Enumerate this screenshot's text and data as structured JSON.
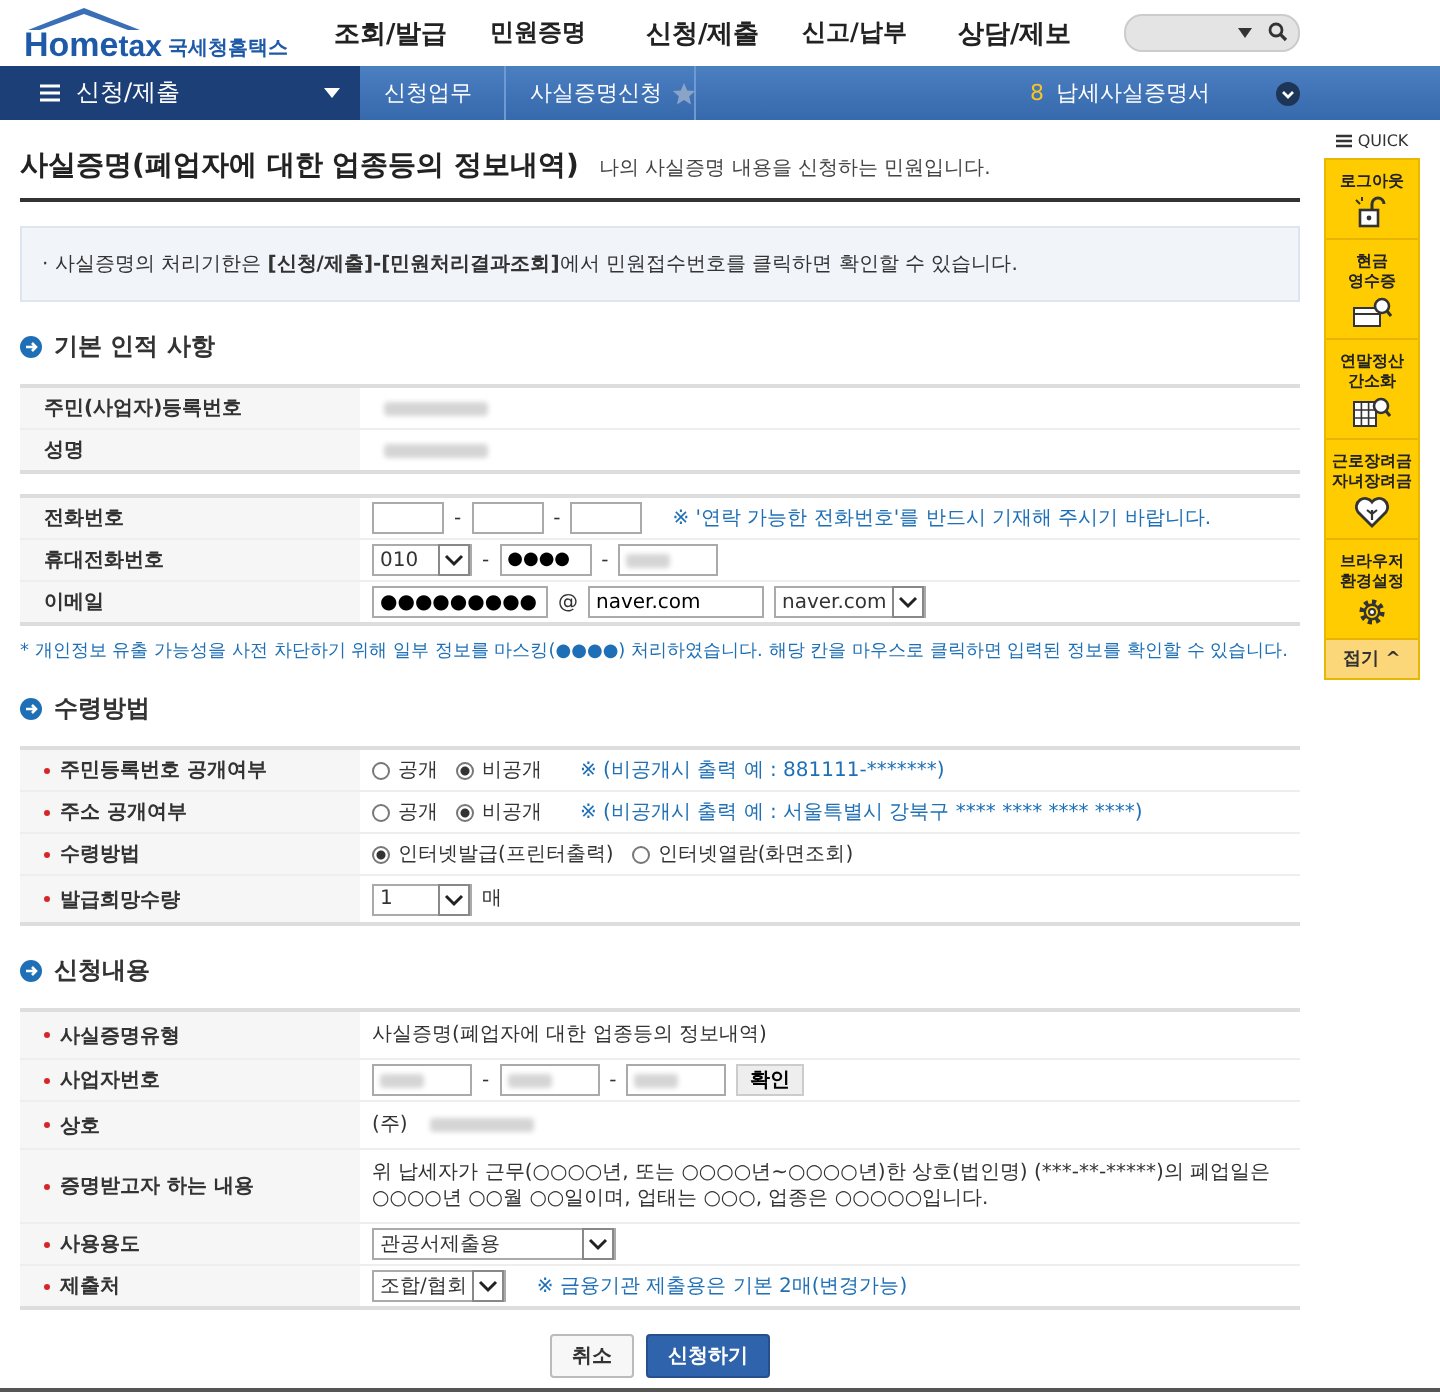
{
  "header": {
    "logo_text": "Home",
    "logo_accent": "tax",
    "logo_name": "국세청홈택스",
    "nav": [
      "조회/발급",
      "민원증명",
      "신청/제출",
      "신고/납부",
      "상담/제보"
    ]
  },
  "subnav": {
    "menu": "신청/제출",
    "crumbs": [
      "신청업무",
      "사실증명신청"
    ],
    "notice_count": "8",
    "notice": "납세사실증명서"
  },
  "title": "사실증명(폐업자에 대한 업종등의 정보내역)",
  "subtitle": "나의 사실증명 내용을 신청하는 민원입니다.",
  "info": "· 사실증명의 처리기한은 **[신청/제출]-[민원처리결과조회]**에서 민원접수번호를 클릭하면 확인할 수 있습니다.",
  "sections": [
    {
      "heading": "기본 인적 사항",
      "tables": [
        [
          {
            "label": "주민(사업자)등록번호",
            "required": false,
            "parts": [
              {
                "kind": "blurred"
              }
            ]
          },
          {
            "label": "성명",
            "required": false,
            "parts": [
              {
                "kind": "blurred"
              }
            ]
          }
        ],
        [
          {
            "label": "전화번호",
            "required": false,
            "parts": [
              {
                "kind": "input"
              },
              {
                "kind": "sep",
                "text": "-"
              },
              {
                "kind": "input"
              },
              {
                "kind": "sep",
                "text": "-"
              },
              {
                "kind": "input"
              },
              {
                "kind": "note",
                "text": "※ '연락 가능한 전화번호'를 반드시 기재해 주시기 바랍니다."
              }
            ]
          },
          {
            "label": "휴대전화번호",
            "required": false,
            "parts": [
              {
                "kind": "select",
                "value": "010"
              },
              {
                "kind": "sep",
                "text": "-"
              },
              {
                "kind": "input",
                "value": "●●●●"
              },
              {
                "kind": "sep",
                "text": "-"
              },
              {
                "kind": "blurred-input"
              }
            ]
          },
          {
            "label": "이메일",
            "required": false,
            "parts": [
              {
                "kind": "wide-input",
                "value": "●●●●●●●●●"
              },
              {
                "kind": "sep",
                "text": "@"
              },
              {
                "kind": "wide-input",
                "value": "naver.com"
              },
              {
                "kind": "select",
                "value": "naver.com"
              }
            ]
          }
        ]
      ],
      "note": "* 개인정보 유출 가능성을 사전 차단하기 위해 일부 정보를 마스킹(●●●●) 처리하였습니다. 해당 칸을 마우스로 클릭하면 입력된 정보를 확인할 수 있습니다."
    },
    {
      "heading": "수령방법",
      "tables": [
        [
          {
            "label": "주민등록번호 공개여부",
            "required": true,
            "parts": [
              {
                "kind": "radio",
                "text": "공개",
                "selected": false
              },
              {
                "kind": "radio",
                "text": "비공개",
                "selected": true
              },
              {
                "kind": "note",
                "text": "※ (비공개시 출력 예 : 881111-*******)"
              }
            ]
          },
          {
            "label": "주소 공개여부",
            "required": true,
            "parts": [
              {
                "kind": "radio",
                "text": "공개",
                "selected": false
              },
              {
                "kind": "radio",
                "text": "비공개",
                "selected": true
              },
              {
                "kind": "note",
                "text": "※ (비공개시 출력 예 : 서울특별시 강북구 **** **** **** ****)"
              }
            ]
          },
          {
            "label": "수령방법",
            "required": true,
            "parts": [
              {
                "kind": "radio",
                "text": "인터넷발급(프린터출력)",
                "selected": true
              },
              {
                "kind": "radio",
                "text": "인터넷열람(화면조회)",
                "selected": false
              }
            ]
          },
          {
            "label": "발급희망수량",
            "required": true,
            "parts": [
              {
                "kind": "select",
                "value": "1"
              },
              {
                "kind": "text",
                "text": "매"
              }
            ]
          }
        ]
      ]
    },
    {
      "heading": "신청내용",
      "tables": [
        [
          {
            "label": "사실증명유형",
            "required": true,
            "parts": [
              {
                "kind": "text",
                "text": "사실증명(폐업자에 대한 업종등의 정보내역)"
              }
            ]
          },
          {
            "label": "사업자번호",
            "required": true,
            "parts": [
              {
                "kind": "blurred-input"
              },
              {
                "kind": "sep",
                "text": "-"
              },
              {
                "kind": "blurred-input"
              },
              {
                "kind": "sep",
                "text": "-"
              },
              {
                "kind": "blurred-input"
              },
              {
                "kind": "button",
                "text": "확인"
              }
            ]
          },
          {
            "label": "상호",
            "required": true,
            "parts": [
              {
                "kind": "text",
                "text": "(주)"
              },
              {
                "kind": "blurred"
              }
            ]
          },
          {
            "label": "증명받고자 하는 내용",
            "required": true,
            "parts": [
              {
                "kind": "text",
                "text": "위 납세자가 근무(○○○○년, 또는 ○○○○년~○○○○년)한 상호(법인명) (***-**-*****)의 폐업일은 ○○○○년 ○○월 ○○일이며, 업태는 ○○○, 업종은 ○○○○○입니다."
              }
            ]
          },
          {
            "label": "사용용도",
            "required": true,
            "parts": [
              {
                "kind": "wide-select",
                "value": "관공서제출용"
              }
            ]
          },
          {
            "label": "제출처",
            "required": true,
            "parts": [
              {
                "kind": "select",
                "value": "조합/협회"
              },
              {
                "kind": "note",
                "text": "※ 금융기관 제출용은 기본 2매(변경가능)"
              }
            ]
          }
        ]
      ]
    }
  ],
  "buttons": [
    {
      "label": "취소",
      "primary": false
    },
    {
      "label": "신청하기",
      "primary": true
    }
  ],
  "quick": {
    "title": "QUICK",
    "items": [
      {
        "label": "로그아웃"
      },
      {
        "label": "현금\n영수증"
      },
      {
        "label": "연말정산\n간소화"
      },
      {
        "label": "근로장려금\n자녀장려금"
      },
      {
        "label": "브라우저\n환경설정"
      }
    ],
    "collapse": "접기 ^"
  }
}
